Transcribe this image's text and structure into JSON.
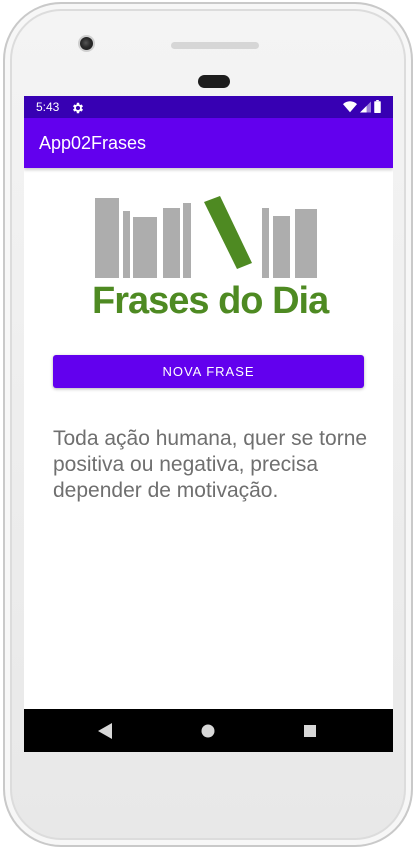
{
  "status_bar": {
    "time": "5:43",
    "icons": [
      "settings-gear-icon",
      "wifi-icon",
      "cell-signal-icon",
      "battery-icon"
    ],
    "color": "#3700b3"
  },
  "app_bar": {
    "title": "App02Frases",
    "color": "#6200ee"
  },
  "logo": {
    "text": "Frases do Dia",
    "bar_color": "#adadad",
    "accent_color": "#4e8a22"
  },
  "main": {
    "button_label": "NOVA FRASE",
    "phrase": "Toda ação humana, quer se torne positiva ou negativa, precisa depender de motivação."
  },
  "nav_bar": {
    "icons": [
      "back-icon",
      "home-icon",
      "recents-icon"
    ]
  }
}
